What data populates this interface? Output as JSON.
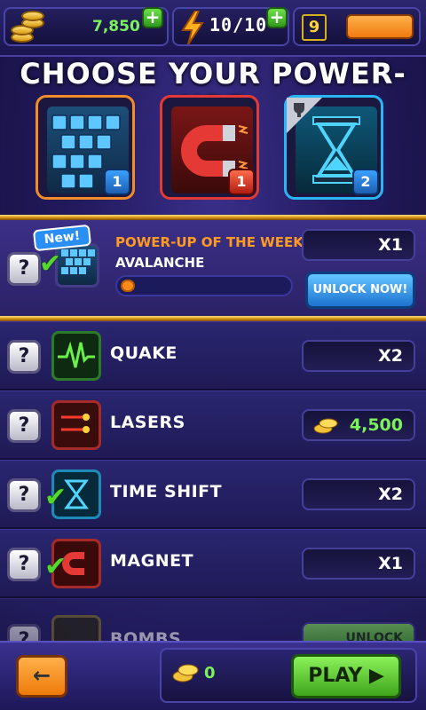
{
  "top_bar": {
    "coins": "7,850",
    "energy": "10/10",
    "gems": "9",
    "add_label": "+"
  },
  "title": "CHOOSE YOUR POWER-UPS",
  "selected_powerups": [
    {
      "name": "Avalanche",
      "icon": "grid-blocks-icon",
      "badge": "1",
      "border_color": "#f28c28"
    },
    {
      "name": "Magnet",
      "icon": "magnet-icon",
      "badge": "1",
      "border_color": "#e53935"
    },
    {
      "name": "Time Shift",
      "icon": "hourglass-icon",
      "badge": "2",
      "border_color": "#29b6f6"
    }
  ],
  "power_week": {
    "new_tag": "New!",
    "title": "POWER-UP OF THE WEEK",
    "name": "AVALANCHE",
    "count": "X1",
    "unlock_label": "UNLOCK NOW!",
    "progress": 0.05
  },
  "powerups": [
    {
      "name": "QUAKE",
      "icon": "quake-icon",
      "count": "X2",
      "checked": false
    },
    {
      "name": "LASERS",
      "icon": "lasers-icon",
      "count": "4,500",
      "checked": false
    },
    {
      "name": "TIME SHIFT",
      "icon": "hourglass-icon",
      "count": "X2",
      "checked": true
    },
    {
      "name": "MAGNET",
      "icon": "magnet-icon",
      "count": "X1",
      "checked": true
    },
    {
      "name": "BOMBS",
      "icon": "bomb-icon",
      "count": "UNLOCK",
      "checked": false
    }
  ],
  "help_label": "?",
  "bottom_bar": {
    "back_label": "←",
    "coins": "0",
    "play_label": "PLAY ▶"
  }
}
